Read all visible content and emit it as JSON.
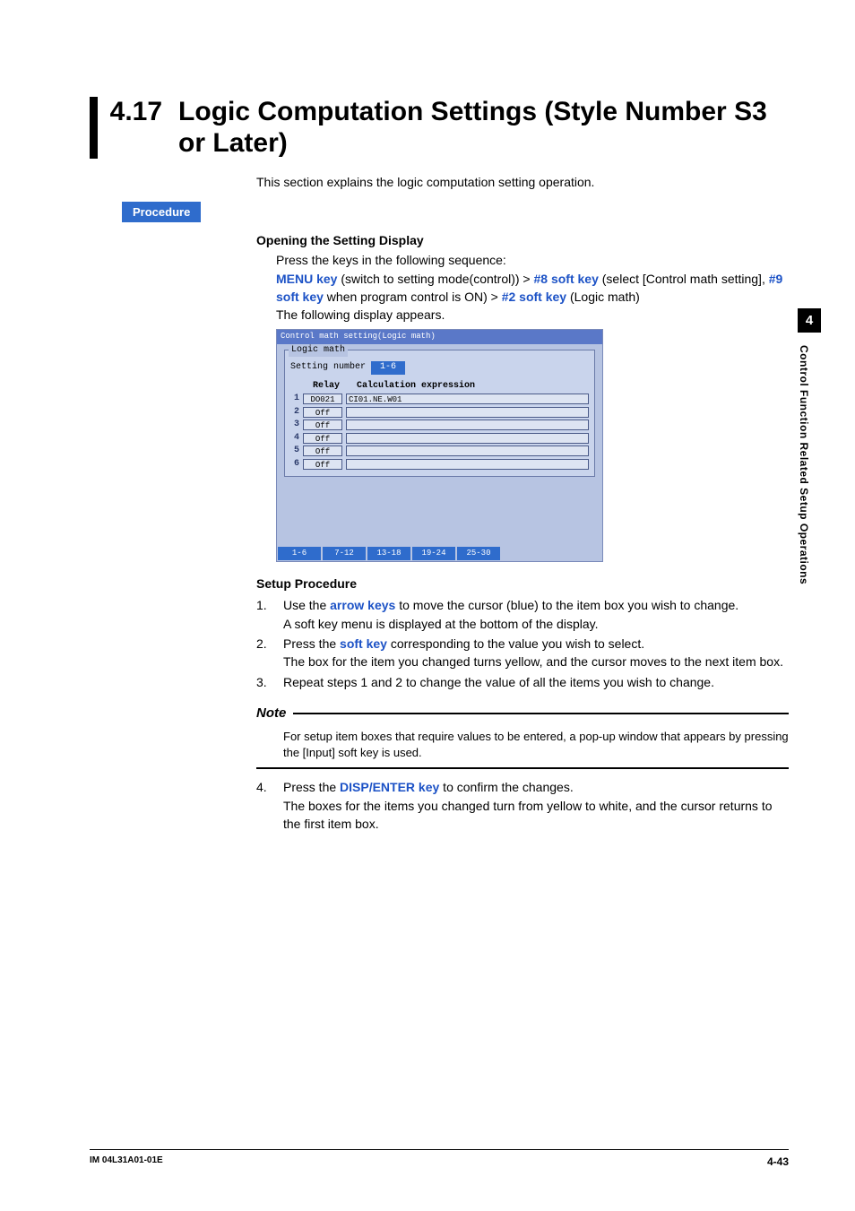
{
  "sideTab": {
    "chapter": "4",
    "label": "Control Function Related Setup Operations"
  },
  "section": {
    "number": "4.17",
    "title": "Logic Computation Settings (Style Number S3 or Later)"
  },
  "intro": "This section explains the logic computation setting operation.",
  "procedureLabel": "Procedure",
  "opening": {
    "heading": "Opening the Setting Display",
    "lead": "Press the keys in the following sequence:",
    "seq": {
      "menuKey": "MENU key",
      "menuAfter": " (switch to setting mode(control)) > ",
      "k8": "#8 soft key",
      "k8After": " (select [Control math setting], ",
      "k9": "#9 soft key",
      "k9After": " when program control is ON) > ",
      "k2": "#2 soft key",
      "k2After": " (Logic math)"
    },
    "follows": "The following display appears."
  },
  "screenshot": {
    "titlebar": "Control math setting(Logic math)",
    "groupLabel": "Logic math",
    "settingLabel": "Setting number",
    "settingVal": "1-6",
    "headRelay": "Relay",
    "headCalc": "Calculation expression",
    "rows": [
      {
        "n": "1",
        "relay": "DO021",
        "calc": "CI01.NE.W01"
      },
      {
        "n": "2",
        "relay": "Off",
        "calc": ""
      },
      {
        "n": "3",
        "relay": "Off",
        "calc": ""
      },
      {
        "n": "4",
        "relay": "Off",
        "calc": ""
      },
      {
        "n": "5",
        "relay": "Off",
        "calc": ""
      },
      {
        "n": "6",
        "relay": "Off",
        "calc": ""
      }
    ],
    "tabs": [
      "1-6",
      "7-12",
      "13-18",
      "19-24",
      "25-30"
    ]
  },
  "setup": {
    "heading": "Setup Procedure",
    "steps": [
      {
        "n": "1.",
        "pre": "Use the ",
        "key": "arrow keys",
        "post": " to move the cursor (blue) to the item box you wish to change.",
        "extra": "A soft key menu is displayed at the bottom of the display."
      },
      {
        "n": "2.",
        "pre": "Press the ",
        "key": "soft key",
        "post": " corresponding to the value you wish to select.",
        "extra": "The box for the item you changed turns yellow, and the cursor moves to the next item box."
      },
      {
        "n": "3.",
        "pre": "",
        "key": "",
        "post": "Repeat steps 1 and 2 to change the value of all the items you wish to change.",
        "extra": ""
      }
    ],
    "note": {
      "label": "Note",
      "body": "For setup item boxes that require values to be entered, a pop-up window that appears by pressing the [Input] soft key is used."
    },
    "step4": {
      "n": "4.",
      "pre": "Press the ",
      "key": "DISP/ENTER key",
      "post": " to confirm the changes.",
      "extra": "The boxes for the items you changed turn from yellow to white, and the cursor returns to the first item box."
    }
  },
  "footer": {
    "left": "IM 04L31A01-01E",
    "right": "4-43"
  }
}
